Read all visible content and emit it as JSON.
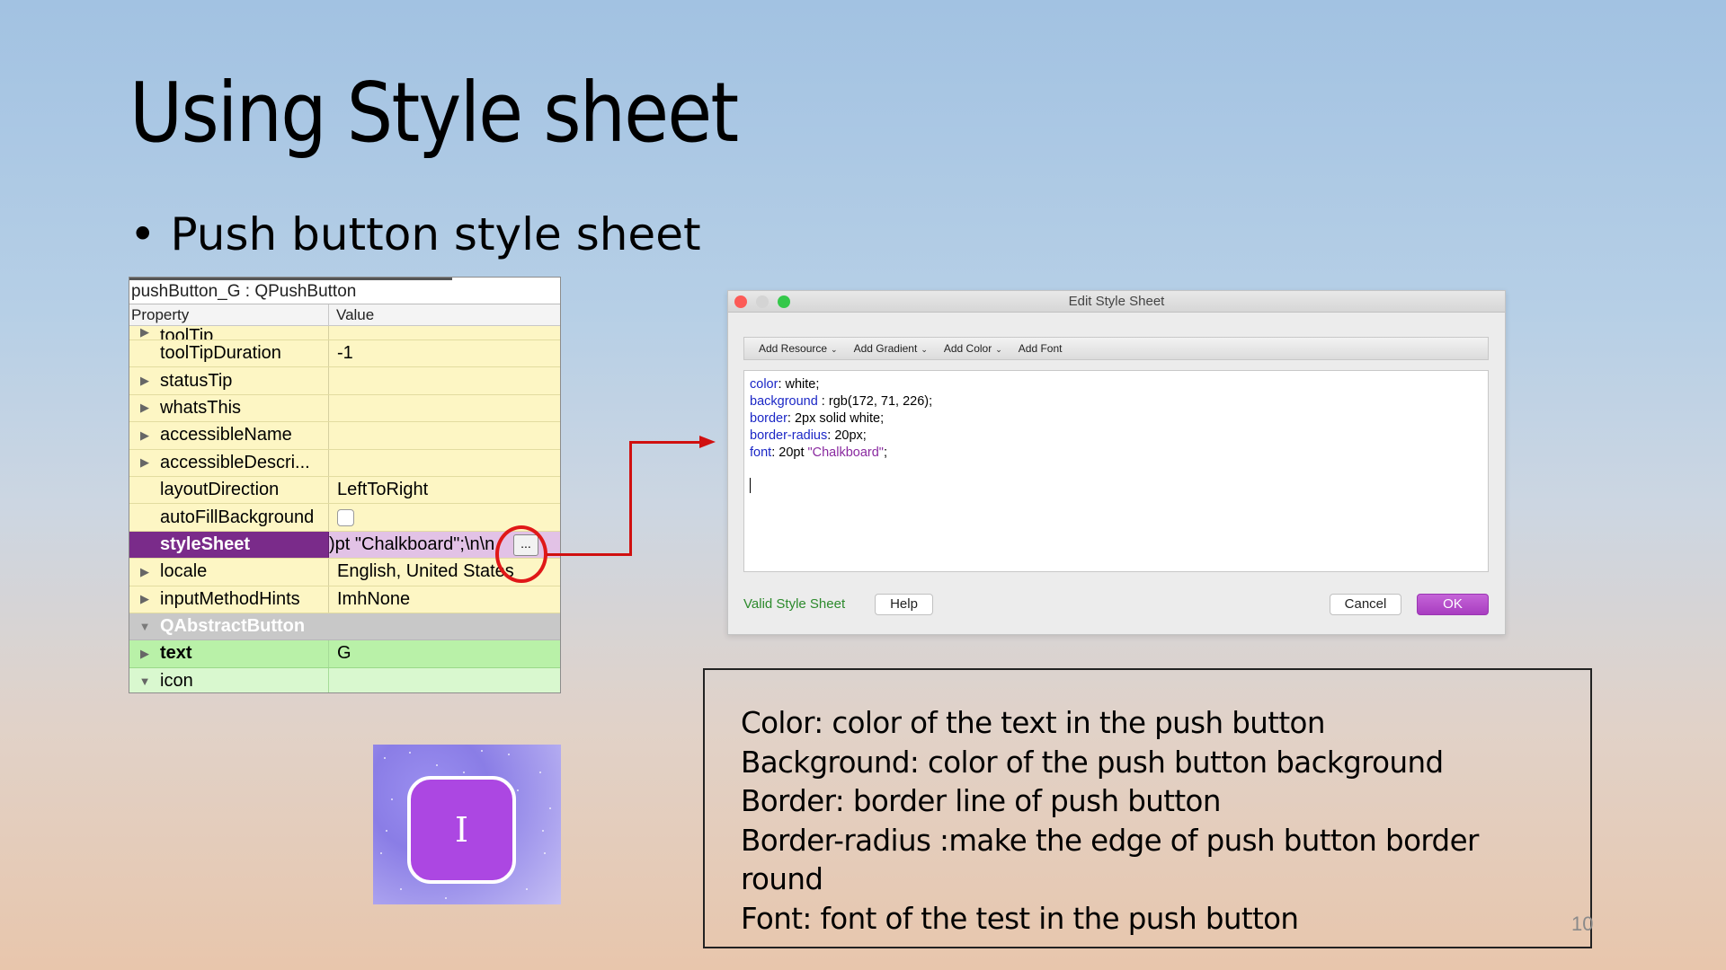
{
  "slide": {
    "title": "Using Style sheet",
    "bullet": "Push button style sheet",
    "page_number": "10"
  },
  "property_editor": {
    "object_label": "pushButton_G : QPushButton",
    "col_property": "Property",
    "col_value": "Value",
    "rows": [
      {
        "name": "toolTip",
        "value": "",
        "expandable": true
      },
      {
        "name": "toolTipDuration",
        "value": "-1",
        "expandable": false
      },
      {
        "name": "statusTip",
        "value": "",
        "expandable": true
      },
      {
        "name": "whatsThis",
        "value": "",
        "expandable": true
      },
      {
        "name": "accessibleName",
        "value": "",
        "expandable": true
      },
      {
        "name": "accessibleDescri...",
        "value": "",
        "expandable": true
      },
      {
        "name": "layoutDirection",
        "value": "LeftToRight",
        "expandable": false
      },
      {
        "name": "autoFillBackground",
        "value": "",
        "expandable": false,
        "checkbox": true
      },
      {
        "name": "styleSheet",
        "value": ")pt \"Chalkboard\";\\n\\n",
        "expandable": false,
        "selected": true
      },
      {
        "name": "locale",
        "value": "English, United States",
        "expandable": true
      },
      {
        "name": "inputMethodHints",
        "value": "ImhNone",
        "expandable": true
      }
    ],
    "group": "QAbstractButton",
    "group_rows": [
      {
        "name": "text",
        "value": "G",
        "expandable": true
      },
      {
        "name": "icon",
        "value": "",
        "expandable": true
      }
    ],
    "ellipsis_button": "..."
  },
  "sample_button": {
    "label": "I",
    "background_color": "#ac47e2",
    "text_color": "#ffffff"
  },
  "dialog": {
    "title": "Edit Style Sheet",
    "toolbar": [
      "Add Resource",
      "Add Gradient",
      "Add Color",
      "Add Font"
    ],
    "toolbar_dropdowns": [
      true,
      true,
      true,
      false
    ],
    "code_lines": [
      {
        "prop": "color",
        "sep": ": ",
        "rest": "white;",
        "str": ""
      },
      {
        "prop": "background",
        "sep": " : ",
        "rest": "rgb(172, 71, 226);",
        "str": ""
      },
      {
        "prop": "border",
        "sep": ": ",
        "rest": "2px solid white;",
        "str": ""
      },
      {
        "prop": "border-radius",
        "sep": ": ",
        "rest": "20px;",
        "str": ""
      },
      {
        "prop": "font",
        "sep": ": ",
        "rest": "20pt ",
        "str": "\"Chalkboard\"",
        "tail": ";"
      }
    ],
    "status": "Valid Style Sheet",
    "help_label": "Help",
    "cancel_label": "Cancel",
    "ok_label": "OK",
    "ok_color": "#b04cc8"
  },
  "description": [
    "Color: color of the text in the push button",
    "Background: color of the push button background",
    "Border: border line of push button",
    "Border-radius :make the edge of push button border round",
    "Font: font of the test in the push button"
  ]
}
